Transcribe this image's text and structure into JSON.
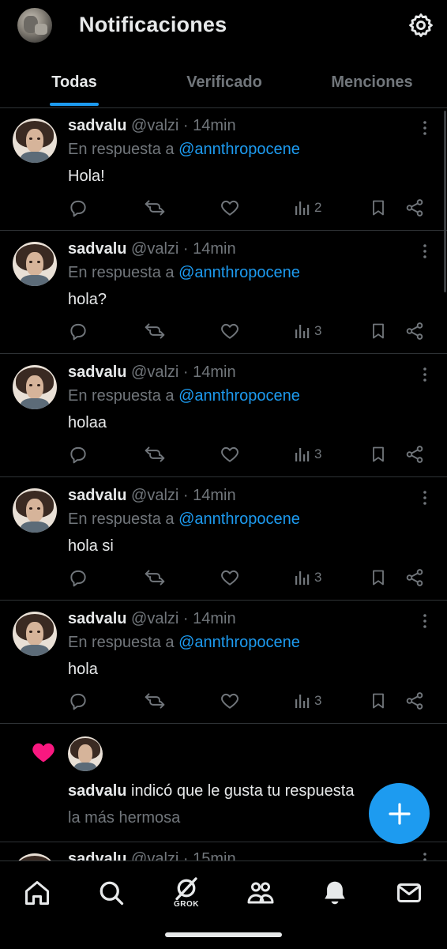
{
  "header": {
    "title": "Notificaciones",
    "tabs": [
      {
        "label": "Todas",
        "active": true
      },
      {
        "label": "Verificado",
        "active": false
      },
      {
        "label": "Menciones",
        "active": false
      }
    ]
  },
  "colors": {
    "accent": "#1d9bf0",
    "like": "#f91880",
    "background": "#000000",
    "muted": "#71767b"
  },
  "notifications": [
    {
      "name": "sadvalu",
      "handle": "@valzi",
      "time": "· 14min",
      "reply_prefix": "En respuesta a",
      "reply_to": "@annthropocene",
      "text": "Hola!",
      "views": "2"
    },
    {
      "name": "sadvalu",
      "handle": "@valzi",
      "time": "· 14min",
      "reply_prefix": "En respuesta a",
      "reply_to": "@annthropocene",
      "text": "hola?",
      "views": "3"
    },
    {
      "name": "sadvalu",
      "handle": "@valzi",
      "time": "· 14min",
      "reply_prefix": "En respuesta a",
      "reply_to": "@annthropocene",
      "text": "holaa",
      "views": "3"
    },
    {
      "name": "sadvalu",
      "handle": "@valzi",
      "time": "· 14min",
      "reply_prefix": "En respuesta a",
      "reply_to": "@annthropocene",
      "text": "hola si",
      "views": "3"
    },
    {
      "name": "sadvalu",
      "handle": "@valzi",
      "time": "· 14min",
      "reply_prefix": "En respuesta a",
      "reply_to": "@annthropocene",
      "text": "hola",
      "views": "3"
    }
  ],
  "like_notification": {
    "name": "sadvalu",
    "text": " indicó que le gusta tu respuesta",
    "quoted": "la más hermosa"
  },
  "partial_item": {
    "name": "sadvalu",
    "handle": "@valzi",
    "time": "· 15min"
  },
  "bottom_nav": {
    "grok_label": "GROK"
  }
}
